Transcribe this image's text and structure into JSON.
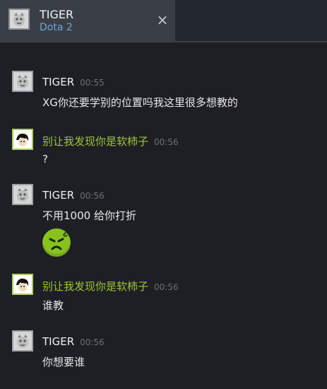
{
  "tab": {
    "title": "TIGER",
    "subtitle": "Dota 2",
    "close_symbol": "×"
  },
  "messages": [
    {
      "sender": "TIGER",
      "time": "00:55",
      "text": "XG你还要学别的位置吗我这里很多想教的"
    },
    {
      "sender": "别让我发现你是软柿子",
      "time": "00:56",
      "text": "?"
    },
    {
      "sender": "TIGER",
      "time": "00:56",
      "text": "不用1000 给你打折",
      "emoji": "angry-face-emoji"
    },
    {
      "sender": "别让我发现你是软柿子",
      "time": "00:56",
      "text": "谁教"
    },
    {
      "sender": "TIGER",
      "time": "00:56",
      "text": "你想要谁"
    }
  ],
  "colors": {
    "background": "#1e1f24",
    "tiger_name": "#f0f0f0",
    "user_name": "#9bc53d",
    "timestamp": "#6b6f75",
    "game_label": "#6fa3d0",
    "emoji": "#89c21e"
  }
}
